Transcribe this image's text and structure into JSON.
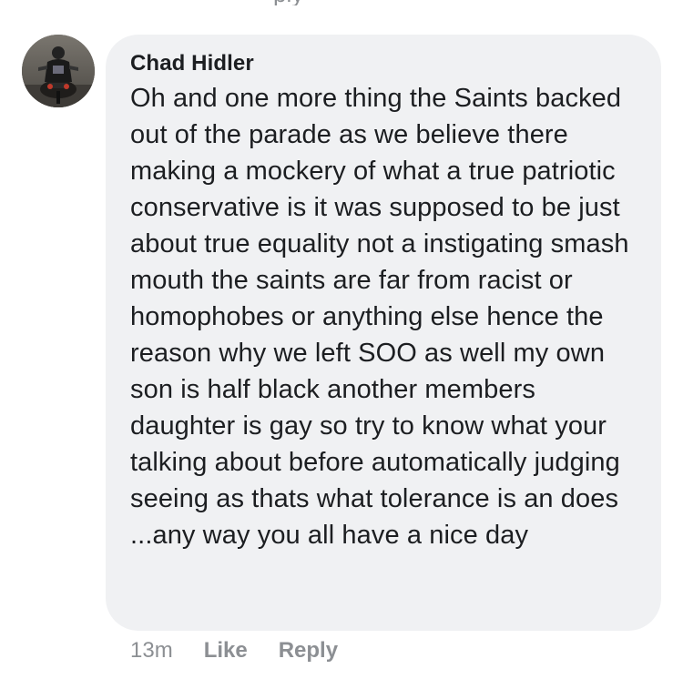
{
  "comment": {
    "author": "Chad Hidler",
    "text": "Oh and one more thing the Saints backed out of the parade as we believe there making a mockery of what a true patriotic conservative is it was supposed to be just about true equality not a instigating smash mouth the saints are far from racist or homophobes or anything else hence the reason why we left SOO as well my own son is half black another members daughter is gay so try to know what your talking about before automatically judging seeing as thats what tolerance is an does ...any way you all have a nice day",
    "timestamp": "13m",
    "like_label": "Like",
    "reply_label": "Reply"
  },
  "previous_comment": {
    "fragment": "ply"
  },
  "colors": {
    "bubble_background": "#f0f1f3",
    "text": "#1c1e21",
    "meta_text": "#8c8f93"
  },
  "icons": {
    "avatar": "motorcycle-rider-photo"
  }
}
